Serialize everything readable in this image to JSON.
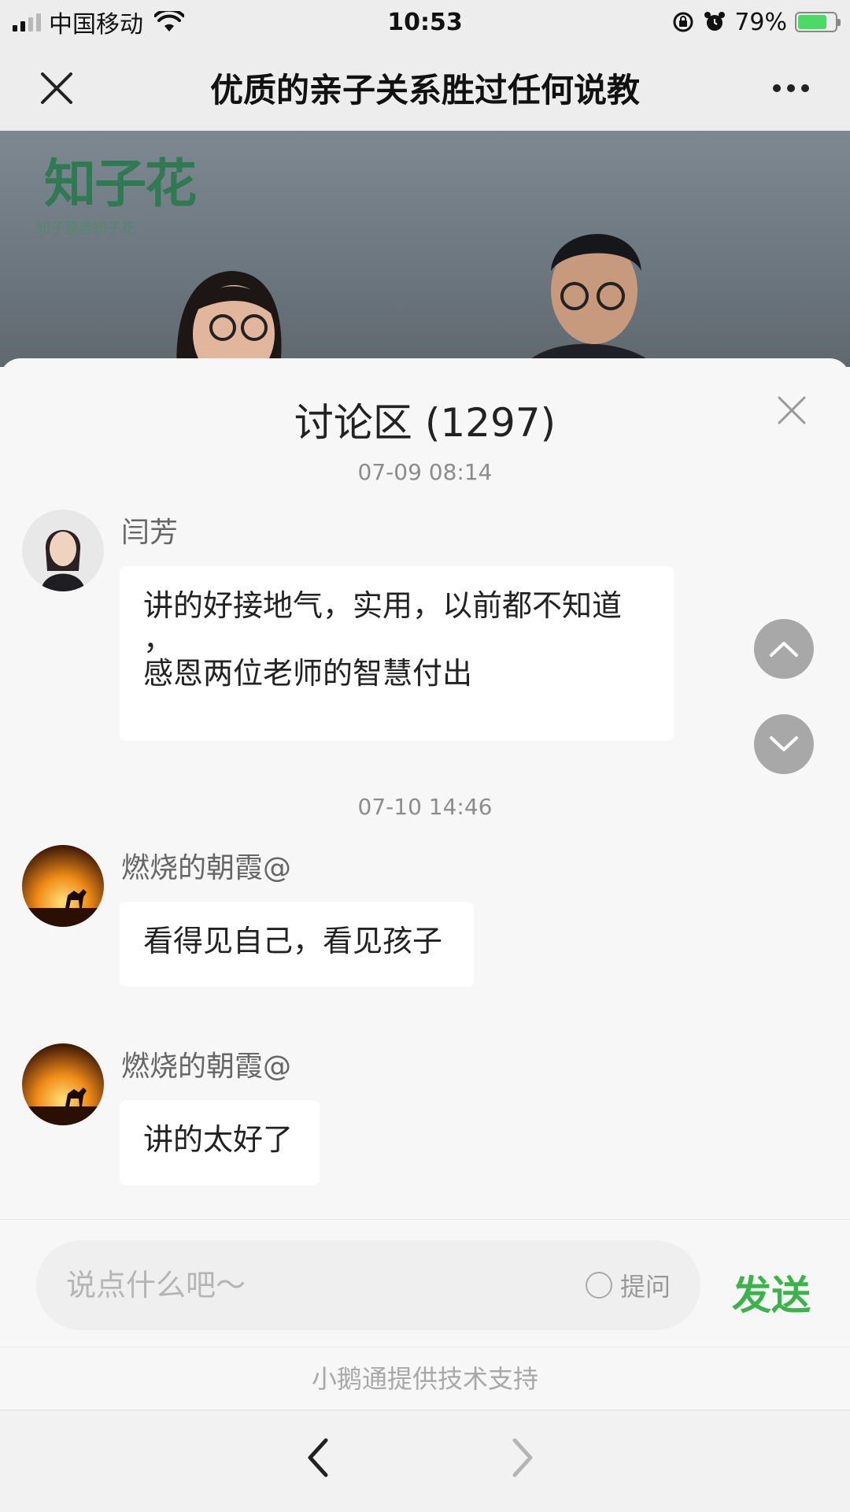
{
  "status_bar": {
    "carrier": "中国移动",
    "time": "10:53",
    "battery_percent_label": "79%",
    "battery_level": 0.79
  },
  "title_bar": {
    "title": "优质的亲子关系胜过任何说教",
    "close_icon": "close-icon",
    "more_icon": "more-icon"
  },
  "video": {
    "logo_text": "知子花",
    "logo_subtitle": "知子莫若知子花"
  },
  "discussion": {
    "title": "讨论区 (1297)",
    "close_icon": "close-icon",
    "groups": [
      {
        "timestamp": "07-09 08:14",
        "messages": [
          {
            "user": "闫芳",
            "avatar": "portrait-avatar",
            "lines": [
              "讲的好接地气，实用，以前都不知道",
              "，",
              "感恩两位老师的智慧付出"
            ]
          }
        ]
      },
      {
        "timestamp": "07-10 14:46",
        "messages": [
          {
            "user": "燃烧的朝霞@",
            "avatar": "sunset-camel-avatar",
            "lines": [
              "看得见自己，看见孩子"
            ]
          },
          {
            "user": "燃烧的朝霞@",
            "avatar": "sunset-camel-avatar",
            "lines": [
              "讲的太好了"
            ]
          }
        ]
      }
    ],
    "scroll_up_icon": "chevron-up-icon",
    "scroll_down_icon": "chevron-down-icon"
  },
  "composer": {
    "placeholder": "说点什么吧～",
    "ask_label": "提问",
    "send_label": "发送"
  },
  "footer": {
    "powered_by": "小鹅通提供技术支持"
  },
  "browser_nav": {
    "back_icon": "chevron-left-icon",
    "forward_icon": "chevron-right-icon"
  },
  "colors": {
    "accent_green": "#3cb34a",
    "logo_green": "#2f7a53",
    "bubble_bg": "#ffffff",
    "page_bg": "#f7f7f7"
  }
}
